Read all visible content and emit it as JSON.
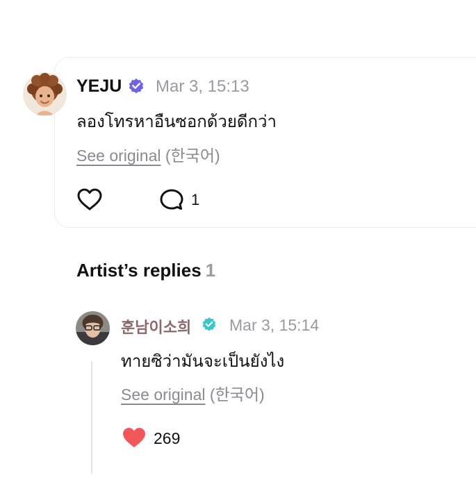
{
  "post": {
    "author": "YEJU",
    "timestamp": "Mar 3, 15:13",
    "text": "ลองโทรหาอืนซอกด้วยดีกว่า",
    "see_original": "See original",
    "original_language": "(한국어)",
    "reply_count": "1"
  },
  "artist_replies": {
    "title": "Artist’s replies",
    "count": "1"
  },
  "reply": {
    "author": "훈남이소희",
    "timestamp": "Mar 3, 15:14",
    "text": "ทายซิว่ามันจะเป็นยังไง",
    "see_original": "See original",
    "original_language": "(한국어)",
    "like_count": "269"
  },
  "colors": {
    "post_badge": "#6e63e6",
    "artist_badge": "#3cc5cc",
    "heart_filled": "#f2575a",
    "muted_text": "#9a9aa2"
  },
  "icons": {
    "post_avatar": "memoji-avatar",
    "like": "heart-outline-icon",
    "comment": "speech-bubble-icon",
    "liked": "heart-filled-icon",
    "verified": "verified-badge-icon"
  }
}
